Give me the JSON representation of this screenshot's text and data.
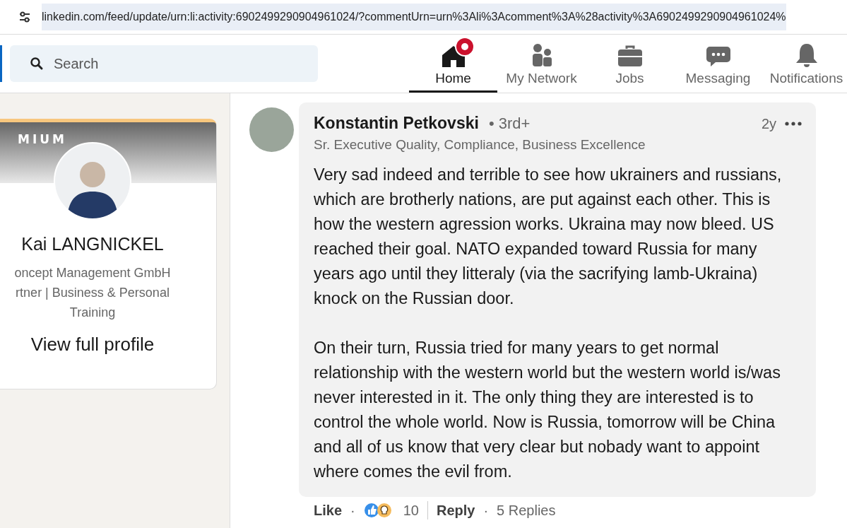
{
  "address_bar": {
    "url": "linkedin.com/feed/update/urn:li:activity:6902499290904961024/?commentUrn=urn%3Ali%3Acomment%3A%28activity%3A6902499290904961024%"
  },
  "search": {
    "placeholder": "Search"
  },
  "nav": [
    {
      "label": "Home",
      "selected": true,
      "kind": "home",
      "badge": true
    },
    {
      "label": "My Network",
      "selected": false,
      "kind": "network",
      "badge": false
    },
    {
      "label": "Jobs",
      "selected": false,
      "kind": "jobs",
      "badge": false
    },
    {
      "label": "Messaging",
      "selected": false,
      "kind": "messaging",
      "badge": false
    },
    {
      "label": "Notifications",
      "selected": false,
      "kind": "notifications",
      "badge": false
    }
  ],
  "profile_card": {
    "premium_label": "MIUM",
    "name": "Kai LANGNICKEL",
    "headline_lines": [
      "oncept Management GmbH",
      "rtner | Business & Personal",
      "Training"
    ],
    "link": "View full profile"
  },
  "comment": {
    "author": "Konstantin Petkovski",
    "degree": "• 3rd+",
    "headline": "Sr. Executive Quality, Compliance, Business Excellence",
    "age": "2y",
    "paragraphs": [
      "Very sad indeed and terrible to see how ukrainers and russians, which are brotherly nations, are put against each other. This is how the western agression works. Ukraina may now bleed. US reached their goal. NATO expanded toward Russia for many years ago until they litteraly (via the sacrifying lamb-Ukraina) knock on the Russian door.",
      "On their turn, Russia tried for many years to get normal relationship with the western world but the western world is/was never interested in it. The only thing they are interested is to control the whole world. Now is Russia, tomorrow will be China and all of us know that very clear but nobady want to appoint where comes the evil from."
    ],
    "like": "Like",
    "like_separator": "·",
    "reaction_count": "10",
    "reply": "Reply",
    "reply_separator": "·",
    "replies": "5 Replies"
  }
}
